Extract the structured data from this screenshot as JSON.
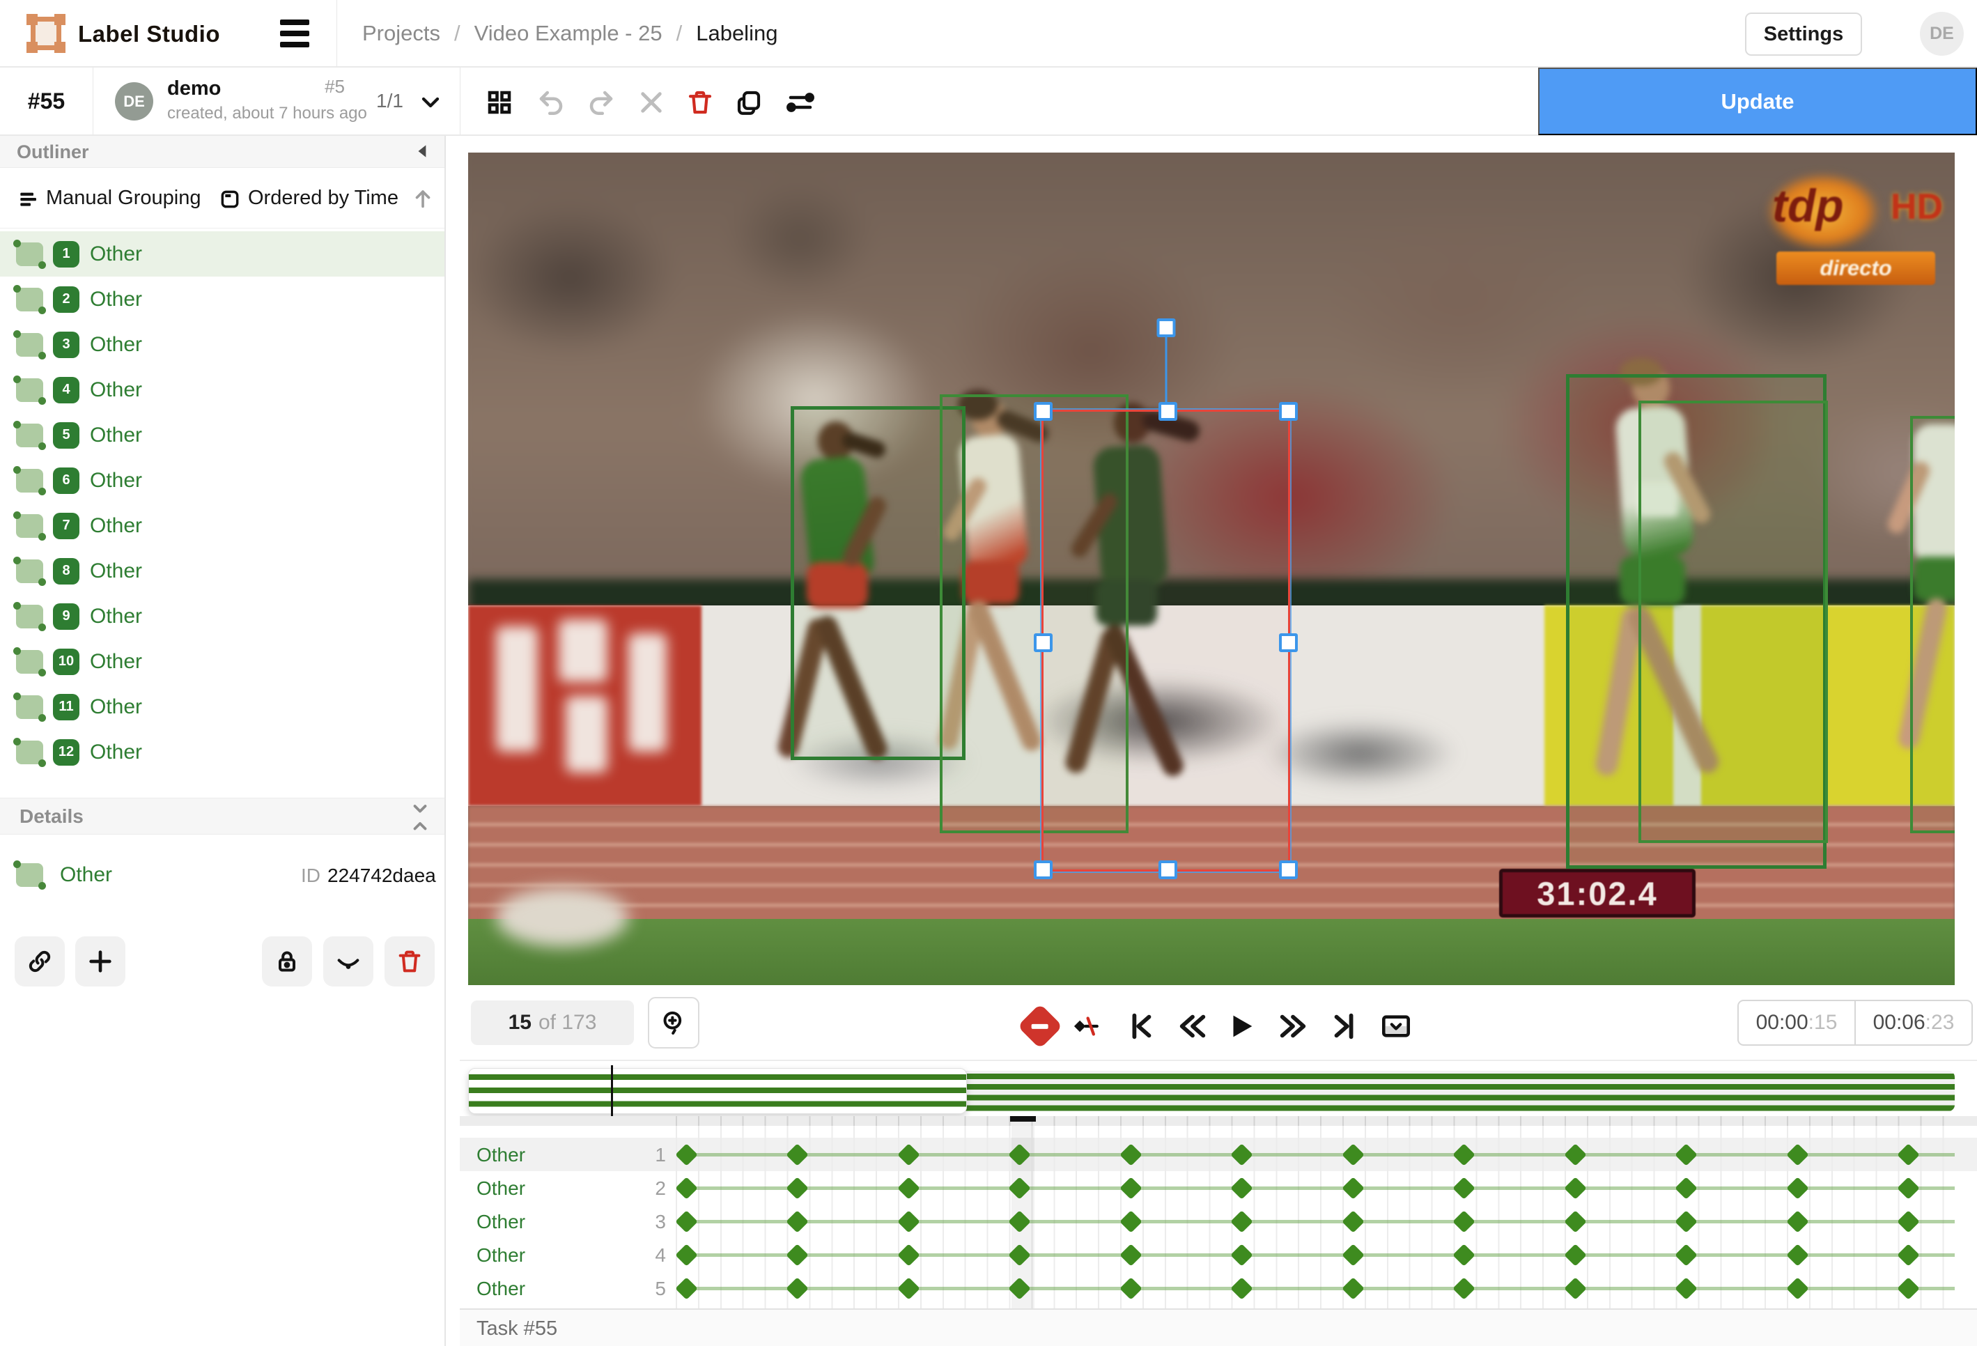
{
  "header": {
    "app_name": "Label Studio",
    "breadcrumbs": [
      "Projects",
      "Video Example - 25",
      "Labeling"
    ],
    "separator": "/",
    "settings_label": "Settings",
    "avatar_initials": "DE"
  },
  "toolbar": {
    "task_number": "#55",
    "annotator_initials": "DE",
    "annotator_name": "demo",
    "annotation_meta": "created, about 7 hours ago",
    "annotation_id": "#5",
    "pager": "1/1",
    "update_label": "Update"
  },
  "outliner": {
    "title": "Outliner",
    "grouping_label": "Manual Grouping",
    "ordering_label": "Ordered by Time",
    "regions": [
      {
        "index": "1",
        "label": "Other",
        "selected": true
      },
      {
        "index": "2",
        "label": "Other",
        "selected": false
      },
      {
        "index": "3",
        "label": "Other",
        "selected": false
      },
      {
        "index": "4",
        "label": "Other",
        "selected": false
      },
      {
        "index": "5",
        "label": "Other",
        "selected": false
      },
      {
        "index": "6",
        "label": "Other",
        "selected": false
      },
      {
        "index": "7",
        "label": "Other",
        "selected": false
      },
      {
        "index": "8",
        "label": "Other",
        "selected": false
      },
      {
        "index": "9",
        "label": "Other",
        "selected": false
      },
      {
        "index": "10",
        "label": "Other",
        "selected": false
      },
      {
        "index": "11",
        "label": "Other",
        "selected": false
      },
      {
        "index": "12",
        "label": "Other",
        "selected": false
      }
    ]
  },
  "details": {
    "title": "Details",
    "region_label": "Other",
    "id_label": "ID",
    "id_value": "224742daea"
  },
  "video_overlay": {
    "channel_logo": "tdp",
    "hd_badge": "HD",
    "live_badge": "directo",
    "race_clock": "31:02.4"
  },
  "playback": {
    "frame_current": "15",
    "frame_of_label": "of 173",
    "time_current_main": "00:00",
    "time_current_frames": ":15",
    "time_total_main": "00:06",
    "time_total_frames": ":23"
  },
  "timeline": {
    "keyframe_count": 12,
    "rows": [
      {
        "label": "Other",
        "num": "1",
        "selected": true
      },
      {
        "label": "Other",
        "num": "2",
        "selected": false
      },
      {
        "label": "Other",
        "num": "3",
        "selected": false
      },
      {
        "label": "Other",
        "num": "4",
        "selected": false
      },
      {
        "label": "Other",
        "num": "5",
        "selected": false
      }
    ]
  },
  "footer": {
    "task_label": "Task #55"
  },
  "colors": {
    "accent_green": "#2e7d32",
    "keyframe_green": "#3e8b1f",
    "update_blue": "#4f9bf5",
    "handle_blue": "#3c96ea",
    "danger_red": "#cf342b",
    "selected_stroke": "#e8443a"
  }
}
